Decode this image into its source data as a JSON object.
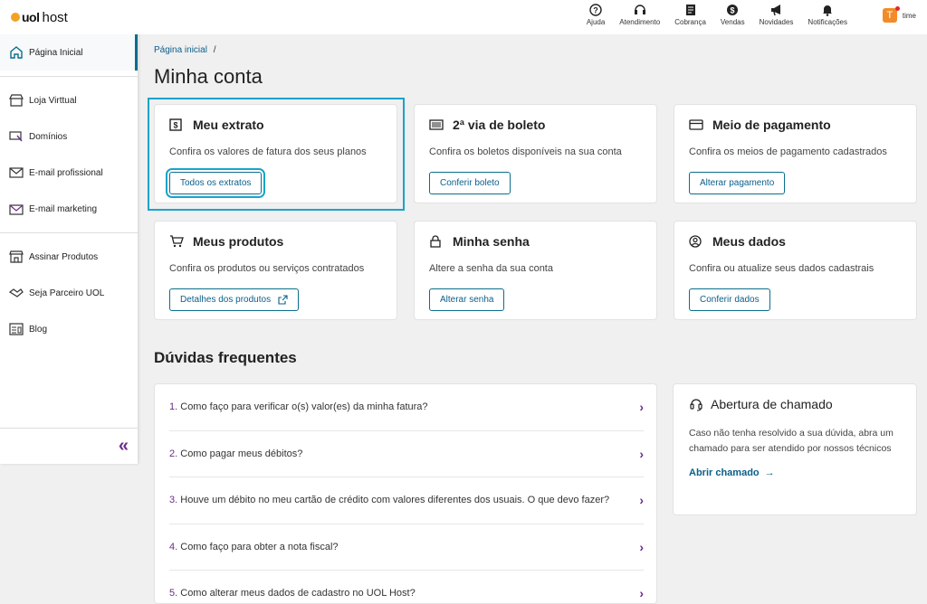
{
  "brand": {
    "logo_uol": "uol",
    "logo_host": "host"
  },
  "sidebar": {
    "items": [
      {
        "label": "Página Inicial"
      },
      {
        "label": "Loja Virttual"
      },
      {
        "label": "Domínios"
      },
      {
        "label": "E-mail profissional"
      },
      {
        "label": "E-mail marketing"
      },
      {
        "label": "Assinar Produtos"
      },
      {
        "label": "Seja Parceiro UOL"
      },
      {
        "label": "Blog"
      }
    ],
    "collapse_label": "«"
  },
  "topbar": {
    "items": [
      {
        "label": "Ajuda",
        "icon": "help-icon"
      },
      {
        "label": "Atendimento",
        "icon": "headset-icon"
      },
      {
        "label": "Cobrança",
        "icon": "receipt-icon"
      },
      {
        "label": "Vendas",
        "icon": "dollar-icon"
      },
      {
        "label": "Novidades",
        "icon": "megaphone-icon"
      },
      {
        "label": "Notificações",
        "icon": "bell-icon"
      }
    ],
    "user": {
      "initial": "T",
      "name": "time"
    }
  },
  "breadcrumb": {
    "home": "Página inicial",
    "sep": "/"
  },
  "page_title": "Minha conta",
  "cards": [
    {
      "title": "Meu extrato",
      "desc": "Confira os valores de fatura dos seus planos",
      "button": "Todos os extratos"
    },
    {
      "title": "2ª via de boleto",
      "desc": "Confira os boletos disponíveis na sua conta",
      "button": "Conferir boleto"
    },
    {
      "title": "Meio de pagamento",
      "desc": "Confira os meios de pagamento cadastrados",
      "button": "Alterar pagamento"
    },
    {
      "title": "Meus produtos",
      "desc": "Confira os produtos ou serviços contratados",
      "button": "Detalhes dos produtos"
    },
    {
      "title": "Minha senha",
      "desc": "Altere a senha da sua conta",
      "button": "Alterar senha"
    },
    {
      "title": "Meus dados",
      "desc": "Confira ou atualize seus dados cadastrais",
      "button": "Conferir dados"
    }
  ],
  "faq": {
    "title": "Dúvidas frequentes",
    "items": [
      {
        "num": "1.",
        "text": "Como faço para verificar o(s) valor(es) da minha fatura?"
      },
      {
        "num": "2.",
        "text": "Como pagar meus débitos?"
      },
      {
        "num": "3.",
        "text": "Houve um débito no meu cartão de crédito com valores diferentes dos usuais. O que devo fazer?"
      },
      {
        "num": "4.",
        "text": "Como faço para obter a nota fiscal?"
      },
      {
        "num": "5.",
        "text": "Como alterar meus dados de cadastro no UOL Host?"
      }
    ]
  },
  "support": {
    "title": "Abertura de chamado",
    "desc": "Caso não tenha resolvido a sua dúvida, abra um chamado para ser atendido por nossos técnicos",
    "link": "Abrir chamado",
    "arrow": "→"
  },
  "colors": {
    "accent": "#0a6e8c",
    "purple": "#6b2b8a",
    "highlight": "#1aa3c9"
  }
}
